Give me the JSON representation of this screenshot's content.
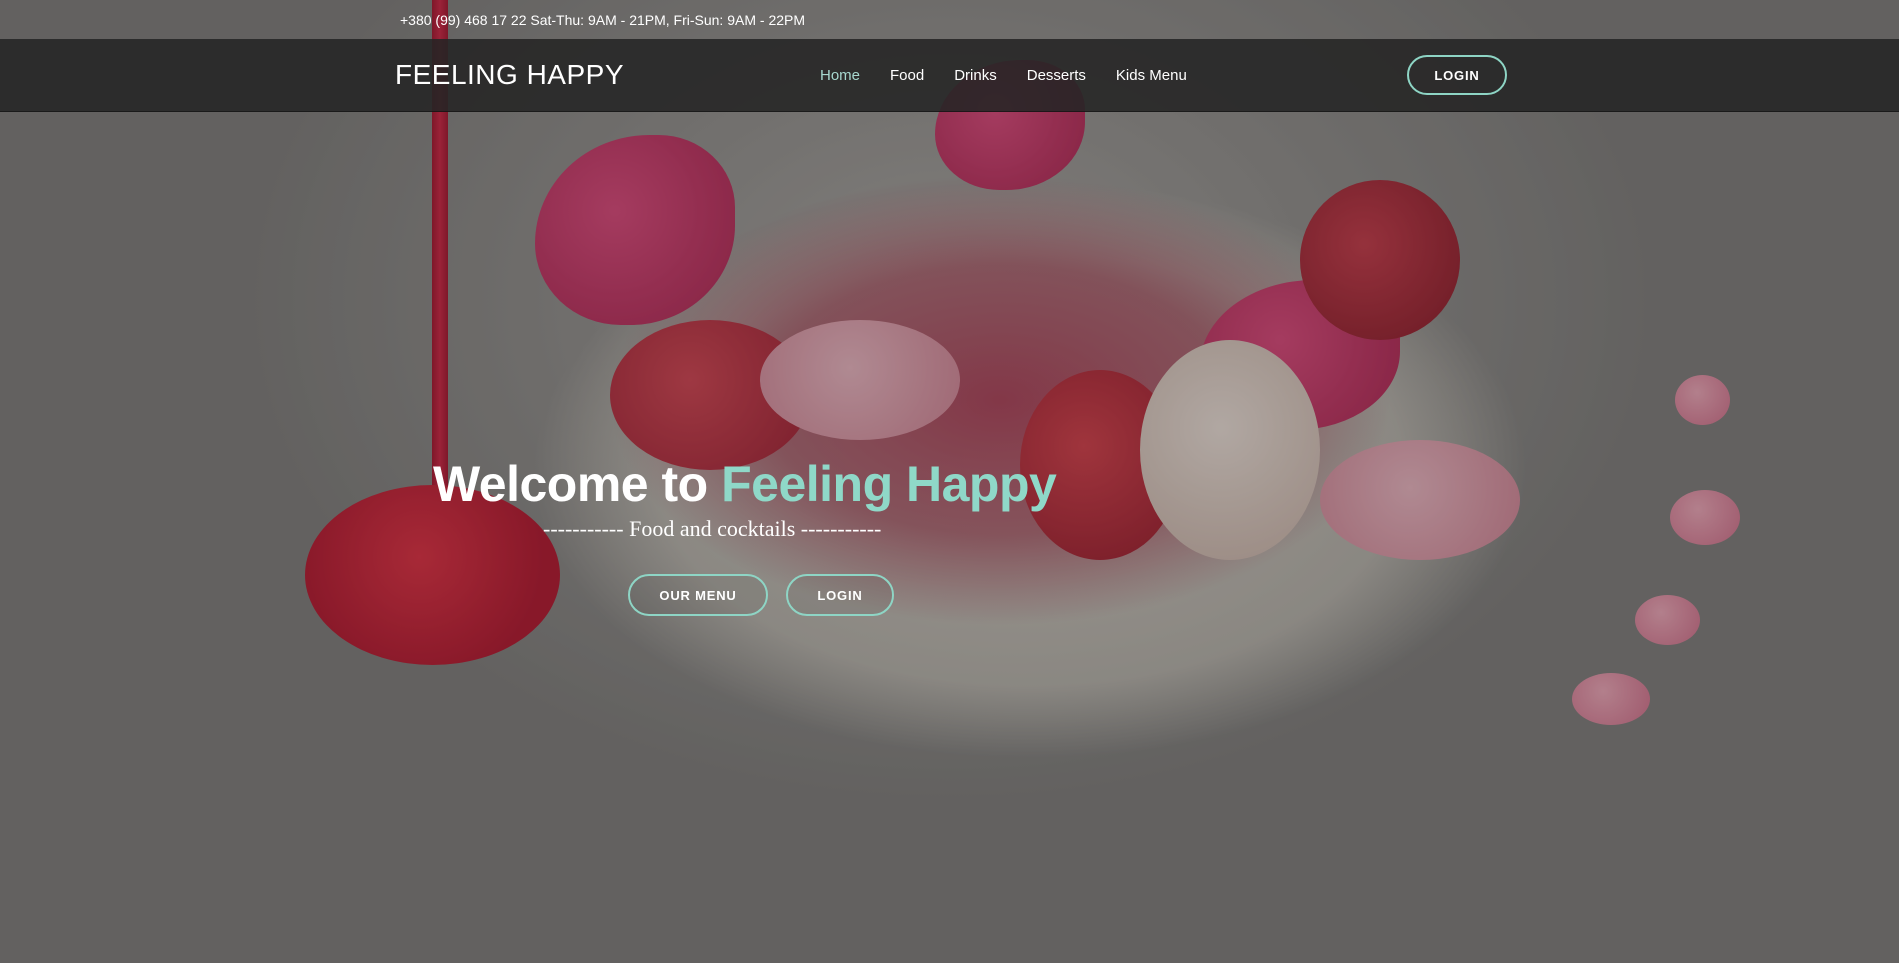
{
  "topbar": {
    "info": "+380 (99) 468 17 22 Sat-Thu: 9AM - 21PM, Fri-Sun: 9AM - 22PM"
  },
  "navbar": {
    "brand": "FEELING HAPPY",
    "links": [
      {
        "label": "Home",
        "active": true
      },
      {
        "label": "Food",
        "active": false
      },
      {
        "label": "Drinks",
        "active": false
      },
      {
        "label": "Desserts",
        "active": false
      },
      {
        "label": "Kids Menu",
        "active": false
      }
    ],
    "login_label": "LOGIN"
  },
  "hero": {
    "title_prefix": "Welcome to ",
    "title_accent": "Feeling Happy",
    "subtitle": "----------- Food and cocktails -----------",
    "menu_button": "OUR MENU",
    "login_button": "LOGIN"
  },
  "colors": {
    "accent": "#8fd8c8",
    "navbar_bg": "#242424"
  }
}
